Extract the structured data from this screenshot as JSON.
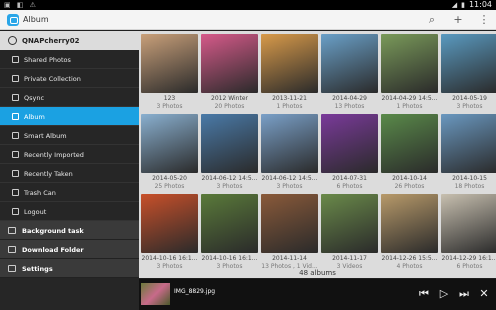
{
  "status": {
    "left_icons": "▣ ◧ ⚠",
    "time": "11:04",
    "battery": "▮",
    "signal": "◢"
  },
  "app": {
    "title": "Album",
    "search_icon": "⌕",
    "add_icon": "+",
    "more_icon": "⋮"
  },
  "sidebar": {
    "account": "QNAPcherry02",
    "items": [
      {
        "label": "Shared Photos"
      },
      {
        "label": "Private Collection"
      },
      {
        "label": "Qsync"
      },
      {
        "label": "Album"
      },
      {
        "label": "Smart Album"
      },
      {
        "label": "Recently Imported"
      },
      {
        "label": "Recently Taken"
      },
      {
        "label": "Trash Can"
      },
      {
        "label": "Logout"
      }
    ],
    "sections": [
      {
        "label": "Background task"
      },
      {
        "label": "Download Folder"
      },
      {
        "label": "Settings"
      }
    ]
  },
  "albums": [
    {
      "name": "123",
      "count": "3 Photos",
      "color": "#c9a07a"
    },
    {
      "name": "2012 Winter",
      "count": "20 Photos",
      "color": "#d65a8a"
    },
    {
      "name": "2013-11-21",
      "count": "1 Photos",
      "color": "#d89a4a"
    },
    {
      "name": "2014-04-29",
      "count": "13 Photos",
      "color": "#6aa0c8"
    },
    {
      "name": "2014-04-29 14:5...",
      "count": "1 Photos",
      "color": "#7a9a5a"
    },
    {
      "name": "2014-05-19",
      "count": "3 Photos",
      "color": "#5a9ac0"
    },
    {
      "name": "2014-05-20",
      "count": "25 Photos",
      "color": "#8ab0d0"
    },
    {
      "name": "2014-06-12 14:5...",
      "count": "3 Photos",
      "color": "#4a7aa8"
    },
    {
      "name": "2014-06-12 14:5...",
      "count": "3 Photos",
      "color": "#7aa0c8"
    },
    {
      "name": "2014-07-31",
      "count": "6 Photos",
      "color": "#7a3a9a"
    },
    {
      "name": "2014-10-14",
      "count": "26 Photos",
      "color": "#5a8a4a"
    },
    {
      "name": "2014-10-15",
      "count": "18 Photos",
      "color": "#6a98c0"
    },
    {
      "name": "2014-10-16 16:1...",
      "count": "3 Photos",
      "color": "#c8502a"
    },
    {
      "name": "2014-10-16 16:1...",
      "count": "3 Photos",
      "color": "#5a7a3a"
    },
    {
      "name": "2014-11-14",
      "count": "13 Photos , 1 Vid...",
      "color": "#8a5a3a"
    },
    {
      "name": "2014-11-17",
      "count": "3 Videos",
      "color": "#6a8a4a"
    },
    {
      "name": "2014-12-26 15:5...",
      "count": "4 Photos",
      "color": "#b89a6a"
    },
    {
      "name": "2014-12-29 16:1...",
      "count": "6 Photos",
      "color": "#c8c0b0"
    }
  ],
  "albums_count": "48 albums",
  "player": {
    "filename": "IMG_8829.jpg",
    "prev_icon": "⏮",
    "play_icon": "▷",
    "next_icon": "⏭",
    "close_icon": "✕"
  }
}
